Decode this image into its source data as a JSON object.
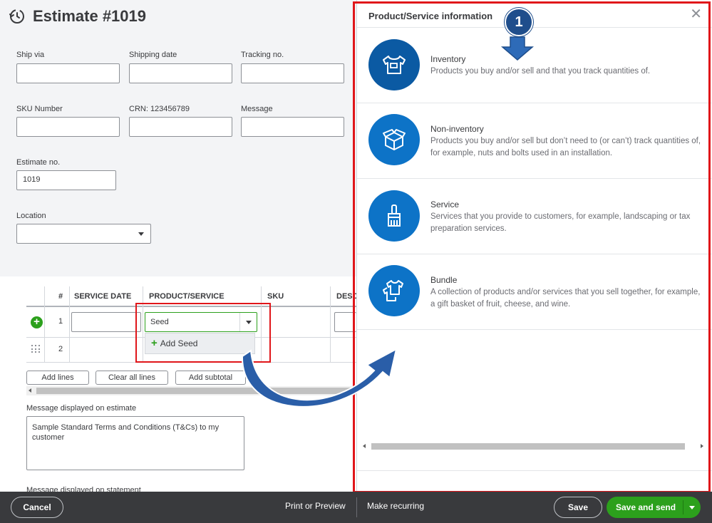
{
  "header": {
    "title": "Estimate #1019",
    "icon": "history-clock-icon"
  },
  "form": {
    "ship_via": {
      "label": "Ship via",
      "value": ""
    },
    "shipping_date": {
      "label": "Shipping date",
      "value": ""
    },
    "tracking_no": {
      "label": "Tracking no.",
      "value": ""
    },
    "sku_number": {
      "label": "SKU Number",
      "value": ""
    },
    "crn": {
      "label": "CRN: 123456789",
      "value": ""
    },
    "message": {
      "label": "Message",
      "value": ""
    },
    "estimate_no": {
      "label": "Estimate no.",
      "value": "1019"
    },
    "location": {
      "label": "Location",
      "value": ""
    }
  },
  "table": {
    "columns": [
      "#",
      "SERVICE DATE",
      "PRODUCT/SERVICE",
      "SKU",
      "DESC"
    ],
    "rows": [
      {
        "num": "1",
        "product": "Seed"
      },
      {
        "num": "2",
        "product": ""
      }
    ],
    "dropdown_option": "Add Seed"
  },
  "actions": {
    "add_lines": "Add lines",
    "clear_all_lines": "Clear all lines",
    "add_subtotal": "Add subtotal"
  },
  "message_on_estimate": {
    "label": "Message displayed on estimate",
    "value": "Sample Standard Terms and Conditions (T&Cs) to my customer"
  },
  "message_on_statement_label": "Message displayed on statement",
  "panel": {
    "title": "Product/Service information",
    "callout_number": "1",
    "items": [
      {
        "name": "Inventory",
        "desc": "Products you buy and/or sell and that you track quantities of.",
        "icon": "shirt-tag-icon"
      },
      {
        "name": "Non-inventory",
        "desc": "Products you buy and/or sell but don’t need to (or can’t) track quantities of, for example, nuts and bolts used in an installation.",
        "icon": "open-box-icon"
      },
      {
        "name": "Service",
        "desc": "Services that you provide to customers, for example, landscaping or tax preparation services.",
        "icon": "paintbrush-icon"
      },
      {
        "name": "Bundle",
        "desc": "A collection of products and/or services that you sell together, for example, a gift basket of fruit, cheese, and wine.",
        "icon": "stacked-shirts-icon"
      }
    ]
  },
  "footer": {
    "cancel": "Cancel",
    "print_or_preview": "Print or Preview",
    "make_recurring": "Make recurring",
    "save": "Save",
    "save_and_send": "Save and send"
  },
  "colors": {
    "accent_green": "#2ca01c",
    "icon_blue": "#0d73c7",
    "annotation_red": "#e0161a",
    "annotation_navy": "#1f4e8c",
    "footer_bg": "#393a3d"
  }
}
